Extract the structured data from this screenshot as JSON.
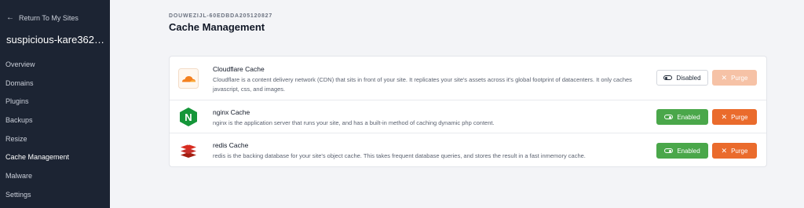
{
  "sidebar": {
    "back_arrow": "←",
    "back_label": "Return To My Sites",
    "site_name": "suspicious-kare362…",
    "items": [
      {
        "label": "Overview"
      },
      {
        "label": "Domains"
      },
      {
        "label": "Plugins"
      },
      {
        "label": "Backups"
      },
      {
        "label": "Resize"
      },
      {
        "label": "Cache Management"
      },
      {
        "label": "Malware"
      },
      {
        "label": "Settings"
      }
    ],
    "active_item": "Cache Management"
  },
  "header": {
    "site_id": "DOUWEZIJL-60EDBDA205120827",
    "title": "Cache Management"
  },
  "caches": [
    {
      "name": "Cloudflare Cache",
      "description": "Cloudflare is a content delivery network (CDN) that sits in front of your site. It replicates your site's assets across it's global footprint of datacenters. It only caches javascript, css, and images.",
      "status_label": "Disabled",
      "purge_label": "Purge",
      "icon": "cloudflare-logo"
    },
    {
      "name": "nginx Cache",
      "description": "nginx is the application server that runs your site, and has a built-in method of caching dynamic php content.",
      "status_label": "Enabled",
      "purge_label": "Purge",
      "icon": "nginx-logo"
    },
    {
      "name": "redis Cache",
      "description": "redis is the backing database for your site's object cache. This takes frequent database queries, and stores the result in a fast inmemory cache.",
      "status_label": "Enabled",
      "purge_label": "Purge",
      "icon": "redis-logo"
    }
  ],
  "icons": {
    "close_glyph": "✕",
    "nginx_letter": "N"
  },
  "colors": {
    "sidebar_bg": "#1c2433",
    "enabled_green": "#4aa74a",
    "purge_orange": "#ea6b2c",
    "purge_disabled": "#f6c2a6",
    "cloudflare_orange": "#f48120",
    "nginx_green": "#159639",
    "redis_red": "#d82c20"
  }
}
